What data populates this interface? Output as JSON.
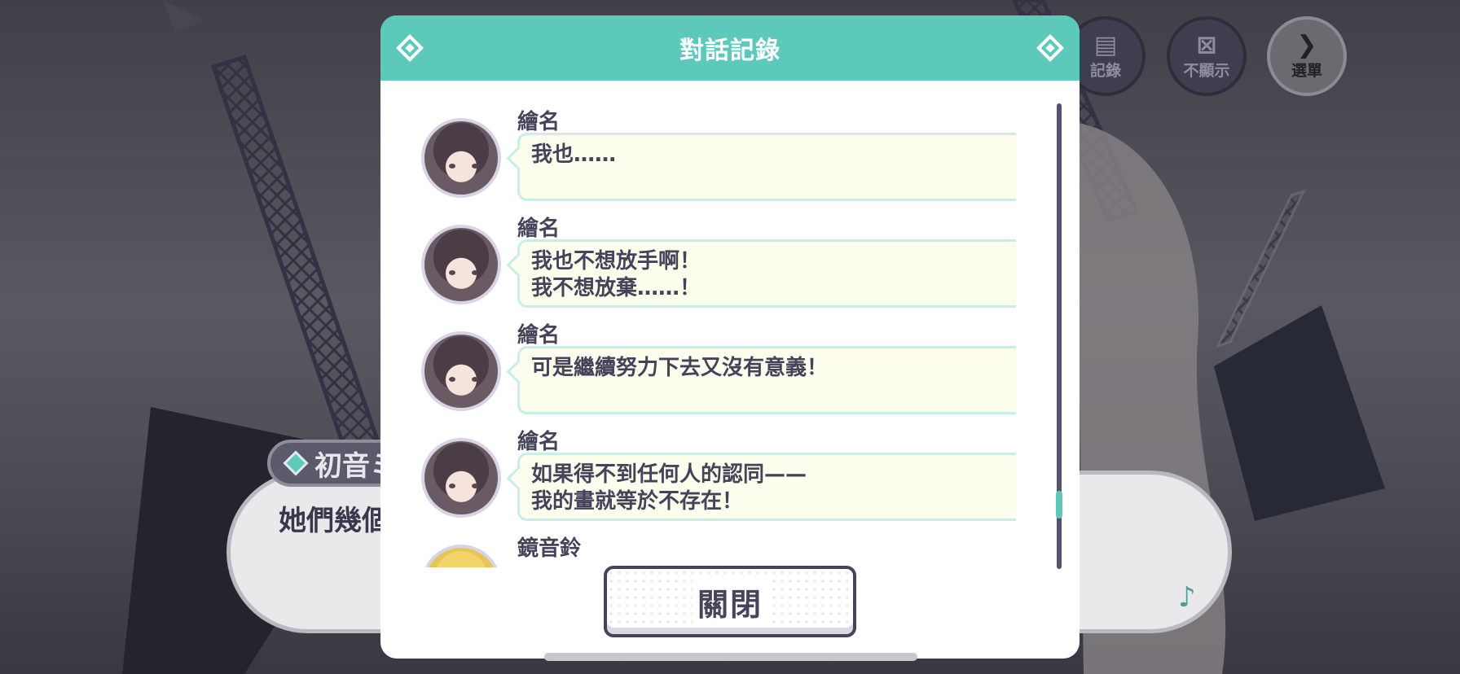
{
  "colors": {
    "accent": "#5dc9ba",
    "text_dark": "#444359",
    "bubble_bg": "#fdfdee",
    "bubble_border": "#c8eee6"
  },
  "top_buttons": {
    "log_label": "記錄",
    "hide_label": "不顯示",
    "menu_label": "選單"
  },
  "story": {
    "speaker_partial": "初音ミ",
    "text_partial": "她們幾個"
  },
  "log_modal": {
    "title": "對話記錄",
    "entries": [
      {
        "speaker": "繪名",
        "text": "我也……"
      },
      {
        "speaker": "繪名",
        "text": "我也不想放手啊！\n我不想放棄……！"
      },
      {
        "speaker": "繪名",
        "text": "可是繼續努力下去又沒有意義！"
      },
      {
        "speaker": "繪名",
        "text": "如果得不到任何人的認同——\n我的畫就等於不存在！"
      }
    ],
    "partial_speaker": "鏡音鈴",
    "close_label": "關閉"
  }
}
